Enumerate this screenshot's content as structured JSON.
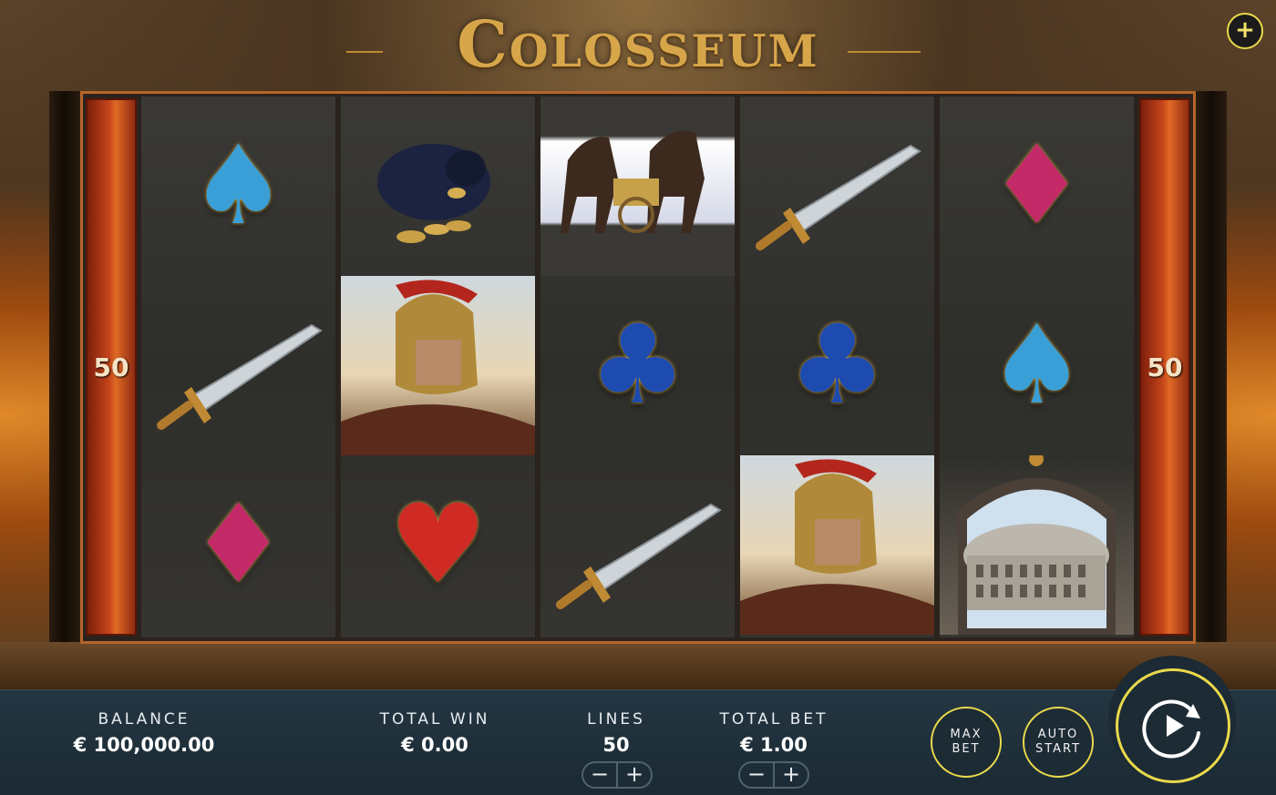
{
  "game": {
    "title": "Colosseum",
    "paylines_left": "50",
    "paylines_right": "50"
  },
  "reels": [
    {
      "symbols": [
        "spade",
        "sword",
        "diamond"
      ]
    },
    {
      "symbols": [
        "coin-bag",
        "warrior",
        "heart"
      ]
    },
    {
      "symbols": [
        "chariot",
        "club",
        "sword"
      ]
    },
    {
      "symbols": [
        "sword",
        "club",
        "warrior"
      ]
    },
    {
      "symbols": [
        "diamond",
        "spade",
        "colosseum"
      ]
    }
  ],
  "symbol_glyphs": {
    "spade": "♠",
    "club": "♣",
    "diamond": "♦",
    "heart": "♥"
  },
  "bar": {
    "balance_label": "BALANCE",
    "balance_value": "€ 100,000.00",
    "total_win_label": "TOTAL WIN",
    "total_win_value": "€ 0.00",
    "lines_label": "LINES",
    "lines_value": "50",
    "total_bet_label": "TOTAL BET",
    "total_bet_value": "€ 1.00",
    "minus": "−",
    "plus": "+",
    "max_bet_label_1": "MAX",
    "max_bet_label_2": "BET",
    "auto_start_label_1": "AUTO",
    "auto_start_label_2": "START"
  },
  "header": {
    "menu_plus": "+"
  },
  "colors": {
    "accent_yellow": "#e9d94b",
    "bar_bg": "#1d2b35",
    "gold": "#d7a64b",
    "side_bar_red": "#c4441a"
  }
}
